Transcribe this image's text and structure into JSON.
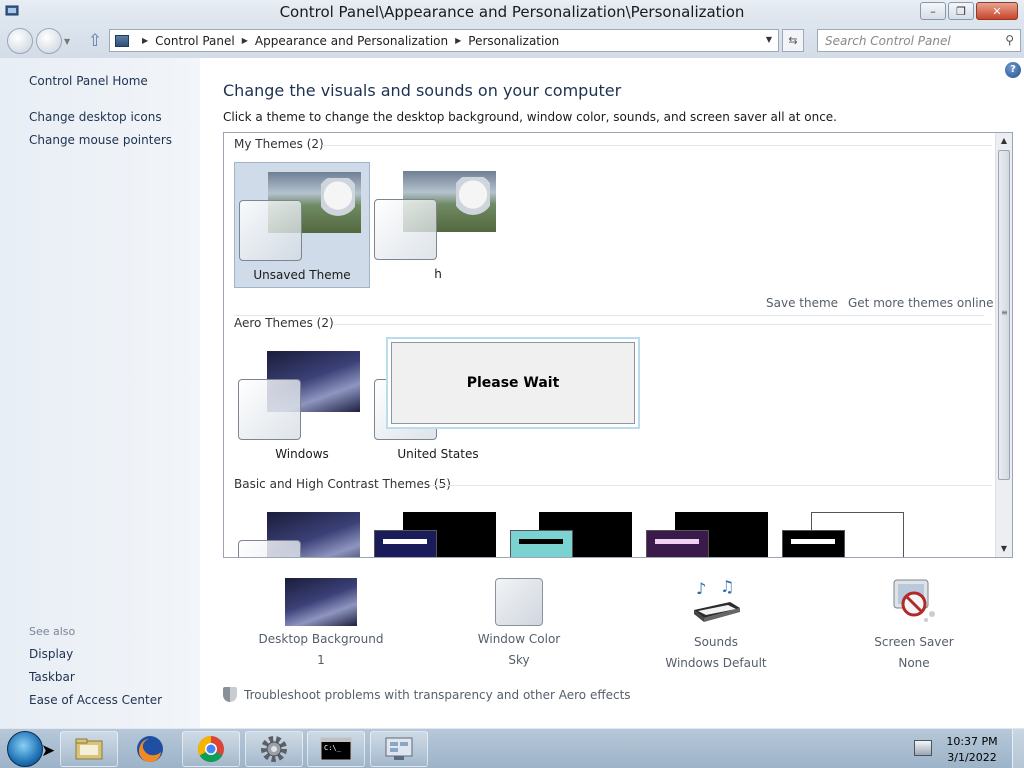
{
  "window": {
    "title": "Control Panel\\Appearance and Personalization\\Personalization",
    "minimize": "–",
    "maximize": "❐",
    "close": "✕"
  },
  "address": {
    "crumbs": [
      "Control Panel",
      "Appearance and Personalization",
      "Personalization"
    ],
    "search_placeholder": "Search Control Panel"
  },
  "sidebar": {
    "home": "Control Panel Home",
    "links": [
      "Change desktop icons",
      "Change mouse pointers"
    ],
    "see_also_label": "See also",
    "see_also": [
      "Display",
      "Taskbar",
      "Ease of Access Center"
    ]
  },
  "main": {
    "heading": "Change the visuals and sounds on your computer",
    "subtext": "Click a theme to change the desktop background, window color, sounds, and screen saver all at once.",
    "help": "?",
    "groups": {
      "my_themes": "My Themes (2)",
      "aero_themes": "Aero Themes (2)",
      "basic_themes": "Basic and High Contrast Themes (5)"
    },
    "my_themes": [
      "Unsaved Theme",
      "h"
    ],
    "aero_themes": [
      "Windows",
      "United States"
    ],
    "save_theme": "Save theme",
    "get_more": "Get more themes online",
    "dialog_text": "Please Wait"
  },
  "bottom": {
    "items": [
      {
        "label": "Desktop Background",
        "value": "1"
      },
      {
        "label": "Window Color",
        "value": "Sky"
      },
      {
        "label": "Sounds",
        "value": "Windows Default"
      },
      {
        "label": "Screen Saver",
        "value": "None"
      }
    ],
    "troubleshoot": "Troubleshoot problems with transparency and other Aero effects"
  },
  "taskbar": {
    "time": "10:37 PM",
    "date": "3/1/2022"
  }
}
